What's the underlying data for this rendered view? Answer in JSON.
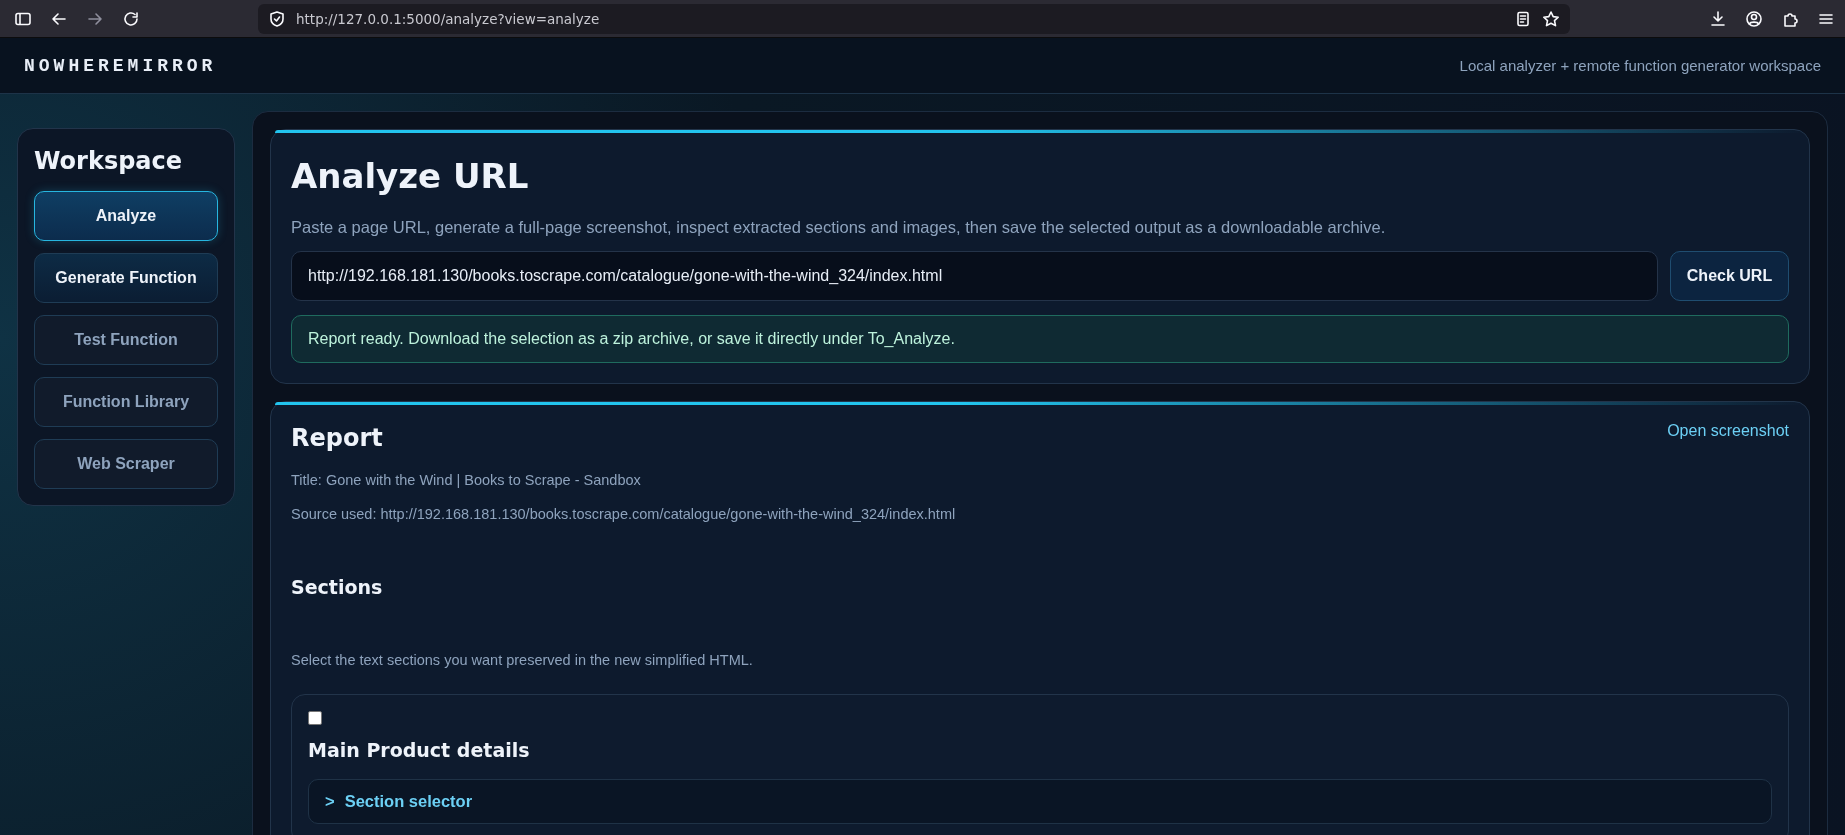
{
  "browser": {
    "url": "http://127.0.0.1:5000/analyze?view=analyze",
    "forward_disabled": true
  },
  "header": {
    "brand": "NOWHEREMIRROR",
    "tagline": "Local analyzer + remote function generator workspace"
  },
  "sidebar": {
    "title": "Workspace",
    "items": [
      {
        "label": "Analyze",
        "selected": true,
        "disabled": false
      },
      {
        "label": "Generate Function",
        "selected": false,
        "disabled": false
      },
      {
        "label": "Test Function",
        "selected": false,
        "disabled": true
      },
      {
        "label": "Function Library",
        "selected": false,
        "disabled": true
      },
      {
        "label": "Web Scraper",
        "selected": false,
        "disabled": true
      }
    ]
  },
  "analyze": {
    "title": "Analyze URL",
    "description": "Paste a page URL, generate a full-page screenshot, inspect extracted sections and images, then save the selected output as a downloadable archive.",
    "url_value": "http://192.168.181.130/books.toscrape.com/catalogue/gone-with-the-wind_324/index.html",
    "button": "Check URL",
    "status": "Report ready. Download the selection as a zip archive, or save it directly under To_Analyze."
  },
  "report": {
    "title": "Report",
    "link": "Open screenshot",
    "lines": [
      "Title: Gone with the Wind | Books to Scrape - Sandbox",
      "Source used: http://192.168.181.130/books.toscrape.com/catalogue/gone-with-the-wind_324/index.html"
    ],
    "sections": {
      "title": "Sections",
      "hint": "Select the text sections you want preserved in the new simplified HTML.",
      "items": [
        {
          "checked": false,
          "title": "Main Product details",
          "details": [
            {
              "marker": ">",
              "label": "Section selector",
              "expanded": false
            }
          ]
        }
      ]
    }
  }
}
